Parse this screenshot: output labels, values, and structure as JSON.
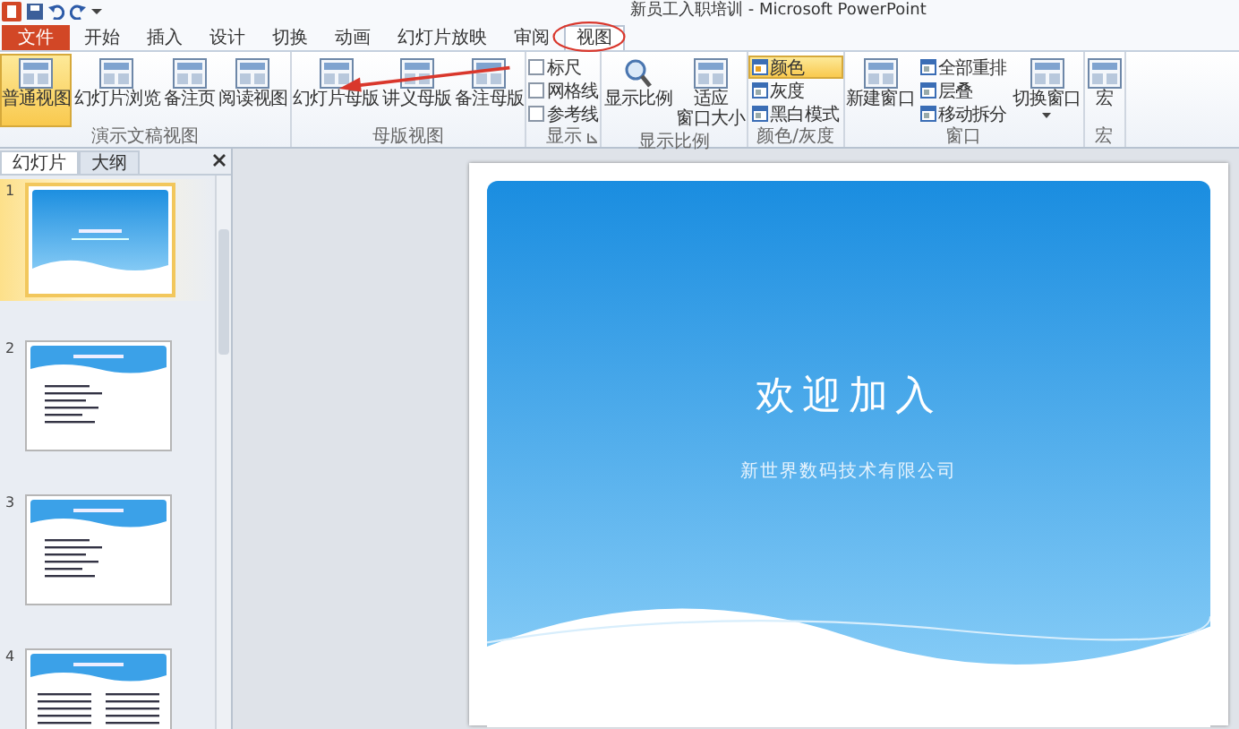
{
  "window": {
    "title": "新员工入职培训 - Microsoft PowerPoint"
  },
  "tabs": [
    {
      "label": "文件",
      "kind": "file",
      "selected": false
    },
    {
      "label": "开始",
      "kind": "tab",
      "selected": false
    },
    {
      "label": "插入",
      "kind": "tab",
      "selected": false
    },
    {
      "label": "设计",
      "kind": "tab",
      "selected": false
    },
    {
      "label": "切换",
      "kind": "tab",
      "selected": false
    },
    {
      "label": "动画",
      "kind": "tab",
      "selected": false
    },
    {
      "label": "幻灯片放映",
      "kind": "tab",
      "selected": false
    },
    {
      "label": "审阅",
      "kind": "tab",
      "selected": false
    },
    {
      "label": "视图",
      "kind": "tab",
      "selected": true
    }
  ],
  "ribbon": {
    "groups": [
      {
        "label": "演示文稿视图",
        "launcher": false,
        "items": [
          {
            "kind": "large",
            "label": "普通视图",
            "selected": true
          },
          {
            "kind": "large",
            "label": "幻灯片浏览",
            "selected": false
          },
          {
            "kind": "large",
            "label": "备注页",
            "selected": false
          },
          {
            "kind": "large",
            "label": "阅读视图",
            "selected": false
          }
        ]
      },
      {
        "label": "母版视图",
        "launcher": false,
        "items": [
          {
            "kind": "large",
            "label": "幻灯片母版",
            "selected": false
          },
          {
            "kind": "large",
            "label": "讲义母版",
            "selected": false
          },
          {
            "kind": "large",
            "label": "备注母版",
            "selected": false
          }
        ]
      },
      {
        "label": "显示",
        "launcher": true,
        "items": [
          {
            "kind": "check",
            "label": "标尺",
            "checked": false
          },
          {
            "kind": "check",
            "label": "网格线",
            "checked": false
          },
          {
            "kind": "check",
            "label": "参考线",
            "checked": false
          }
        ]
      },
      {
        "label": "显示比例",
        "launcher": false,
        "items": [
          {
            "kind": "large",
            "label": "显示比例",
            "selected": false
          },
          {
            "kind": "large",
            "lines": [
              "适应",
              "窗口大小"
            ],
            "selected": false
          }
        ]
      },
      {
        "label": "颜色/灰度",
        "launcher": false,
        "items": [
          {
            "kind": "small",
            "label": "颜色",
            "selected": true
          },
          {
            "kind": "small",
            "label": "灰度",
            "selected": false
          },
          {
            "kind": "small",
            "label": "黑白模式",
            "selected": false
          }
        ]
      },
      {
        "label": "窗口",
        "launcher": false,
        "items": [
          {
            "kind": "large",
            "label": "新建窗口",
            "selected": false
          },
          {
            "kind": "small",
            "label": "全部重排",
            "selected": false
          },
          {
            "kind": "small",
            "label": "层叠",
            "selected": false
          },
          {
            "kind": "small",
            "label": "移动拆分",
            "selected": false
          },
          {
            "kind": "split",
            "label": "切换窗口",
            "selected": false
          }
        ]
      },
      {
        "label": "宏",
        "launcher": false,
        "items": [
          {
            "kind": "large",
            "label": "宏",
            "selected": false
          }
        ]
      }
    ]
  },
  "pane": {
    "tabs": [
      {
        "label": "幻灯片",
        "selected": true
      },
      {
        "label": "大纲",
        "selected": false
      }
    ],
    "thumbnails": [
      {
        "number": "1",
        "kind": "title",
        "selected": true
      },
      {
        "number": "2",
        "kind": "list",
        "selected": false
      },
      {
        "number": "3",
        "kind": "list",
        "selected": false
      },
      {
        "number": "4",
        "kind": "columns",
        "selected": false
      }
    ]
  },
  "slide": {
    "title": "欢迎加入",
    "subtitle": "新世界数码技术有限公司"
  }
}
